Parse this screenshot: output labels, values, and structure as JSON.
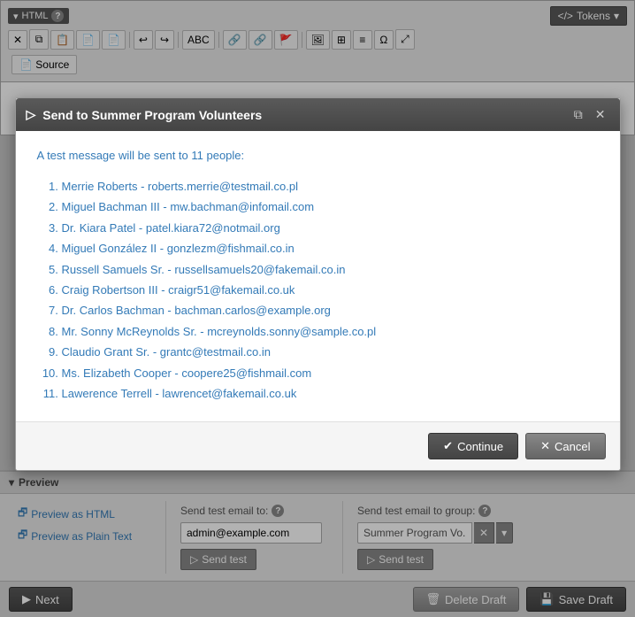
{
  "editor": {
    "title": "HTML",
    "help_icon": "?",
    "tokens_label": "Tokens",
    "source_label": "Source",
    "toolbar": {
      "buttons": [
        "✕",
        "⧉",
        "📋",
        "📄",
        "📄",
        "↩",
        "↪",
        "ABC",
        "🔗",
        "🔗",
        "🚩",
        "🖼",
        "⊞",
        "≡",
        "Ω",
        "⤢"
      ]
    }
  },
  "modal": {
    "title": "Send to Summer Program Volunteers",
    "intro_text": "A test message will be sent to ",
    "count": "11",
    "count_suffix": " people:",
    "recipients": [
      {
        "name": "Merrie Roberts",
        "email": "roberts.merrie@testmail.co.pl"
      },
      {
        "name": "Miguel Bachman III",
        "email": "mw.bachman@infomail.com"
      },
      {
        "name": "Dr. Kiara Patel",
        "email": "patel.kiara72@notmail.org"
      },
      {
        "name": "Miguel González II",
        "email": "gonzlezm@fishmail.co.in"
      },
      {
        "name": "Russell Samuels Sr.",
        "email": "russellsamuels20@fakemail.co.in"
      },
      {
        "name": "Craig Robertson III",
        "email": "craigr51@fakemail.co.uk"
      },
      {
        "name": "Dr. Carlos Bachman",
        "email": "bachman.carlos@example.org"
      },
      {
        "name": "Mr. Sonny McReynolds Sr.",
        "email": "mcreynolds.sonny@sample.co.pl"
      },
      {
        "name": "Claudio Grant Sr.",
        "email": "grantc@testmail.co.in"
      },
      {
        "name": "Ms. Elizabeth Cooper",
        "email": "coopere25@fishmail.com"
      },
      {
        "name": "Lawerence Terrell",
        "email": "lawrencet@fakemail.co.uk"
      }
    ],
    "continue_label": "Continue",
    "cancel_label": "Cancel",
    "continue_icon": "✔",
    "cancel_icon": "✕"
  },
  "preview": {
    "section_label": "Preview",
    "preview_html_label": "Preview as HTML",
    "preview_plain_label": "Preview as Plain Text",
    "send_test_email_label": "Send test email to:",
    "send_test_email_help": "?",
    "send_test_email_value": "admin@example.com",
    "send_test_email_btn": "Send test",
    "send_test_group_label": "Send test email to group:",
    "send_test_group_help": "?",
    "send_test_group_value": "Summer Program Vo...",
    "send_test_group_btn": "Send test"
  },
  "actions": {
    "next_label": "Next",
    "next_icon": "▶",
    "delete_draft_label": "Delete Draft",
    "save_draft_label": "Save Draft",
    "floppy_icon": "💾"
  }
}
